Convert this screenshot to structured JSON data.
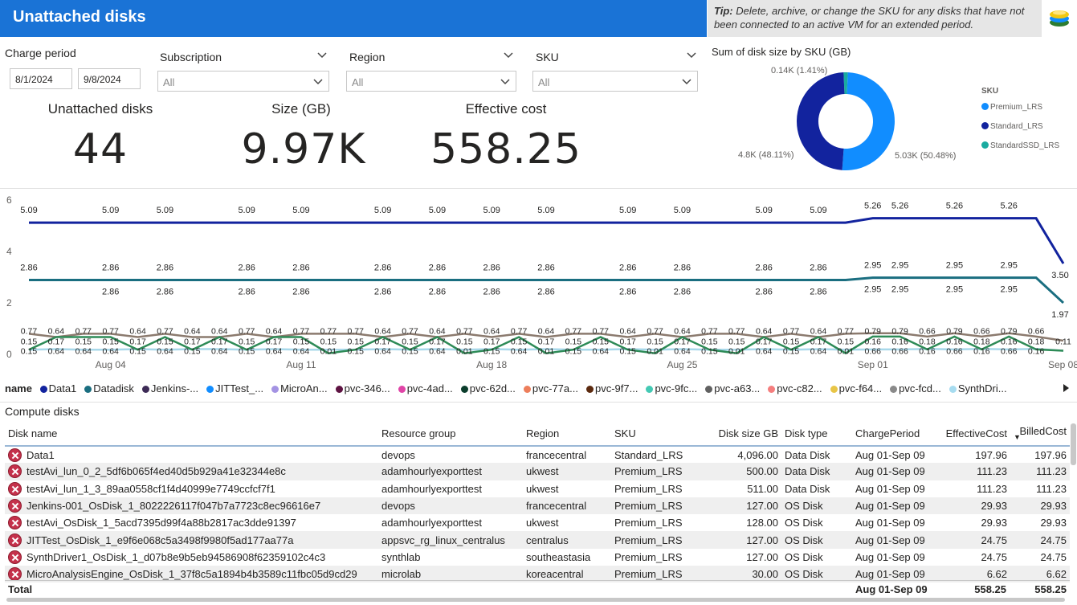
{
  "header": {
    "title": "Unattached disks",
    "tip_bold": "Tip:",
    "tip_text": " Delete, archive, or change the SKU for any disks that have not been connected to an active VM for an extended period.",
    "app_icon": "database-stack-icon"
  },
  "filters": {
    "charge_period_label": "Charge period",
    "start_date": "8/1/2024",
    "end_date": "9/8/2024",
    "subscription_label": "Subscription",
    "subscription_value": "All",
    "region_label": "Region",
    "region_value": "All",
    "sku_label": "SKU",
    "sku_value": "All"
  },
  "kpis": {
    "disks_label": "Unattached disks",
    "disks_value": "44",
    "size_label": "Size (GB)",
    "size_value": "9.97K",
    "cost_label": "Effective cost",
    "cost_value": "558.25"
  },
  "donut": {
    "title": "Sum of disk size by SKU (GB)",
    "legend_title": "SKU",
    "slices": [
      {
        "name": "Premium_LRS",
        "value": 5.03,
        "pct": 50.48,
        "label": "5.03K (50.48%)",
        "color": "#118dff"
      },
      {
        "name": "Standard_LRS",
        "value": 4.8,
        "pct": 48.11,
        "label": "4.8K (48.11%)",
        "color": "#12239e"
      },
      {
        "name": "StandardSSD_LRS",
        "value": 0.14,
        "pct": 1.41,
        "label": "0.14K (1.41%)",
        "color": "#1aaba0"
      }
    ]
  },
  "chart_data": {
    "type": "line",
    "yticks": [
      "6",
      "4",
      "2",
      "0"
    ],
    "ylim": [
      0,
      6
    ],
    "xticks": [
      "Aug 04",
      "Aug 11",
      "Aug 18",
      "Aug 25",
      "Sep 01",
      "Sep 08"
    ],
    "x": [
      "Aug 01",
      "Aug 02",
      "Aug 03",
      "Aug 04",
      "Aug 05",
      "Aug 06",
      "Aug 07",
      "Aug 08",
      "Aug 09",
      "Aug 10",
      "Aug 11",
      "Aug 12",
      "Aug 13",
      "Aug 14",
      "Aug 15",
      "Aug 16",
      "Aug 17",
      "Aug 18",
      "Aug 19",
      "Aug 20",
      "Aug 21",
      "Aug 22",
      "Aug 23",
      "Aug 24",
      "Aug 25",
      "Aug 26",
      "Aug 27",
      "Aug 28",
      "Aug 29",
      "Aug 30",
      "Aug 31",
      "Sep 01",
      "Sep 02",
      "Sep 03",
      "Sep 04",
      "Sep 05",
      "Sep 06",
      "Sep 07",
      "Sep 08"
    ],
    "series": [
      {
        "name": "Data1",
        "color": "#12239e",
        "values": [
          5.09,
          5.09,
          5.09,
          5.09,
          5.09,
          5.09,
          5.09,
          5.09,
          5.09,
          5.09,
          5.09,
          5.09,
          5.09,
          5.09,
          5.09,
          5.09,
          5.09,
          5.09,
          5.09,
          5.09,
          5.09,
          5.09,
          5.09,
          5.09,
          5.09,
          5.09,
          5.09,
          5.09,
          5.09,
          5.09,
          5.09,
          5.26,
          5.26,
          5.26,
          5.26,
          5.26,
          5.26,
          5.26,
          3.5
        ]
      },
      {
        "name": "Datadisk",
        "color": "#1a6e80",
        "values": [
          2.86,
          2.86,
          2.86,
          2.86,
          2.86,
          2.86,
          2.86,
          2.86,
          2.86,
          2.86,
          2.86,
          2.86,
          2.86,
          2.86,
          2.86,
          2.86,
          2.86,
          2.86,
          2.86,
          2.86,
          2.86,
          2.86,
          2.86,
          2.86,
          2.86,
          2.86,
          2.86,
          2.86,
          2.86,
          2.86,
          2.86,
          2.95,
          2.95,
          2.95,
          2.95,
          2.95,
          2.95,
          2.95,
          1.97
        ]
      },
      {
        "name": "Jenkins-...",
        "color": "#8b7a6e",
        "values": [
          0.77,
          0.64,
          0.77,
          0.77,
          0.64,
          0.77,
          0.64,
          0.64,
          0.77,
          0.64,
          0.77,
          0.77,
          0.77,
          0.64,
          0.77,
          0.64,
          0.77,
          0.64,
          0.77,
          0.64,
          0.77,
          0.77,
          0.64,
          0.77,
          0.64,
          0.77,
          0.77,
          0.64,
          0.77,
          0.64,
          0.77,
          0.79,
          0.79,
          0.66,
          0.79,
          0.66,
          0.79,
          0.66,
          0.5
        ]
      },
      {
        "name": "JITTest_...",
        "color": "#a8d8ea",
        "values": [
          0.15,
          0.17,
          0.15,
          0.15,
          0.17,
          0.15,
          0.17,
          0.17,
          0.15,
          0.17,
          0.15,
          0.15,
          0.15,
          0.17,
          0.15,
          0.17,
          0.15,
          0.17,
          0.15,
          0.17,
          0.15,
          0.15,
          0.17,
          0.15,
          0.17,
          0.15,
          0.15,
          0.17,
          0.15,
          0.17,
          0.15,
          0.16,
          0.16,
          0.18,
          0.16,
          0.18,
          0.16,
          0.18,
          0.11
        ]
      },
      {
        "name": "MicroAn...",
        "color": "#2e8b57",
        "values": [
          0.15,
          0.64,
          0.64,
          0.64,
          0.15,
          0.64,
          0.15,
          0.64,
          0.15,
          0.64,
          0.64,
          0.01,
          0.15,
          0.64,
          0.15,
          0.64,
          0.01,
          0.15,
          0.64,
          0.01,
          0.15,
          0.64,
          0.15,
          0.01,
          0.64,
          0.15,
          0.01,
          0.64,
          0.15,
          0.64,
          0.01,
          0.66,
          0.66,
          0.16,
          0.66,
          0.16,
          0.66,
          0.16,
          0.11
        ]
      }
    ],
    "legend_title": "name",
    "legend": [
      {
        "name": "Data1",
        "color": "#12239e"
      },
      {
        "name": "Datadisk",
        "color": "#1a6e80"
      },
      {
        "name": "Jenkins-...",
        "color": "#3d2b56"
      },
      {
        "name": "JITTest_...",
        "color": "#118dff"
      },
      {
        "name": "MicroAn...",
        "color": "#a493e3"
      },
      {
        "name": "pvc-346...",
        "color": "#5e1342"
      },
      {
        "name": "pvc-4ad...",
        "color": "#e044a7"
      },
      {
        "name": "pvc-62d...",
        "color": "#0b3d2c"
      },
      {
        "name": "pvc-77a...",
        "color": "#ed7e5b"
      },
      {
        "name": "pvc-9f7...",
        "color": "#5c2a0f"
      },
      {
        "name": "pvc-9fc...",
        "color": "#44c9b4"
      },
      {
        "name": "pvc-a63...",
        "color": "#616161"
      },
      {
        "name": "pvc-c82...",
        "color": "#f57e7e"
      },
      {
        "name": "pvc-f64...",
        "color": "#e8c547"
      },
      {
        "name": "pvc-fcd...",
        "color": "#8a8a8a"
      },
      {
        "name": "SynthDri...",
        "color": "#a7dcf0"
      }
    ],
    "legend_next_icon": "chevron-right-icon"
  },
  "table": {
    "section_title": "Compute disks",
    "columns": [
      "Disk name",
      "Resource group",
      "Region",
      "SKU",
      "Disk size GB",
      "Disk type",
      "ChargePeriod",
      "EffectiveCost",
      "BilledCost"
    ],
    "rows": [
      [
        "Data1",
        "devops",
        "francecentral",
        "Standard_LRS",
        "4,096.00",
        "Data Disk",
        "Aug 01-Sep 09",
        "197.96",
        "197.96"
      ],
      [
        "testAvi_lun_0_2_5df6b065f4ed40d5b929a41e32344e8c",
        "adamhourlyexporttest",
        "ukwest",
        "Premium_LRS",
        "500.00",
        "Data Disk",
        "Aug 01-Sep 09",
        "111.23",
        "111.23"
      ],
      [
        "testAvi_lun_1_3_89aa0558cf1f4d40999e7749ccfcf7f1",
        "adamhourlyexporttest",
        "ukwest",
        "Premium_LRS",
        "511.00",
        "Data Disk",
        "Aug 01-Sep 09",
        "111.23",
        "111.23"
      ],
      [
        "Jenkins-001_OsDisk_1_8022226117f047b7a7723c8ec96616e7",
        "devops",
        "francecentral",
        "Premium_LRS",
        "127.00",
        "OS Disk",
        "Aug 01-Sep 09",
        "29.93",
        "29.93"
      ],
      [
        "testAvi_OsDisk_1_5acd7395d99f4a88b2817ac3dde91397",
        "adamhourlyexporttest",
        "ukwest",
        "Premium_LRS",
        "128.00",
        "OS Disk",
        "Aug 01-Sep 09",
        "29.93",
        "29.93"
      ],
      [
        "JITTest_OsDisk_1_e9f6e068c5a3498f9980f5ad177aa77a",
        "appsvc_rg_linux_centralus",
        "centralus",
        "Premium_LRS",
        "127.00",
        "OS Disk",
        "Aug 01-Sep 09",
        "24.75",
        "24.75"
      ],
      [
        "SynthDriver1_OsDisk_1_d07b8e9b5eb94586908f62359102c4c3",
        "synthlab",
        "southeastasia",
        "Premium_LRS",
        "127.00",
        "OS Disk",
        "Aug 01-Sep 09",
        "24.75",
        "24.75"
      ],
      [
        "MicroAnalysisEngine_OsDisk_1_37f8c5a1894b4b3589c11fbc05d9cd29",
        "microlab",
        "koreacentral",
        "Premium_LRS",
        "30.00",
        "OS Disk",
        "Aug 01-Sep 09",
        "6.62",
        "6.62"
      ]
    ],
    "total_label": "Total",
    "total_period": "Aug 01-Sep 09",
    "total_effective": "558.25",
    "total_billed": "558.25"
  }
}
